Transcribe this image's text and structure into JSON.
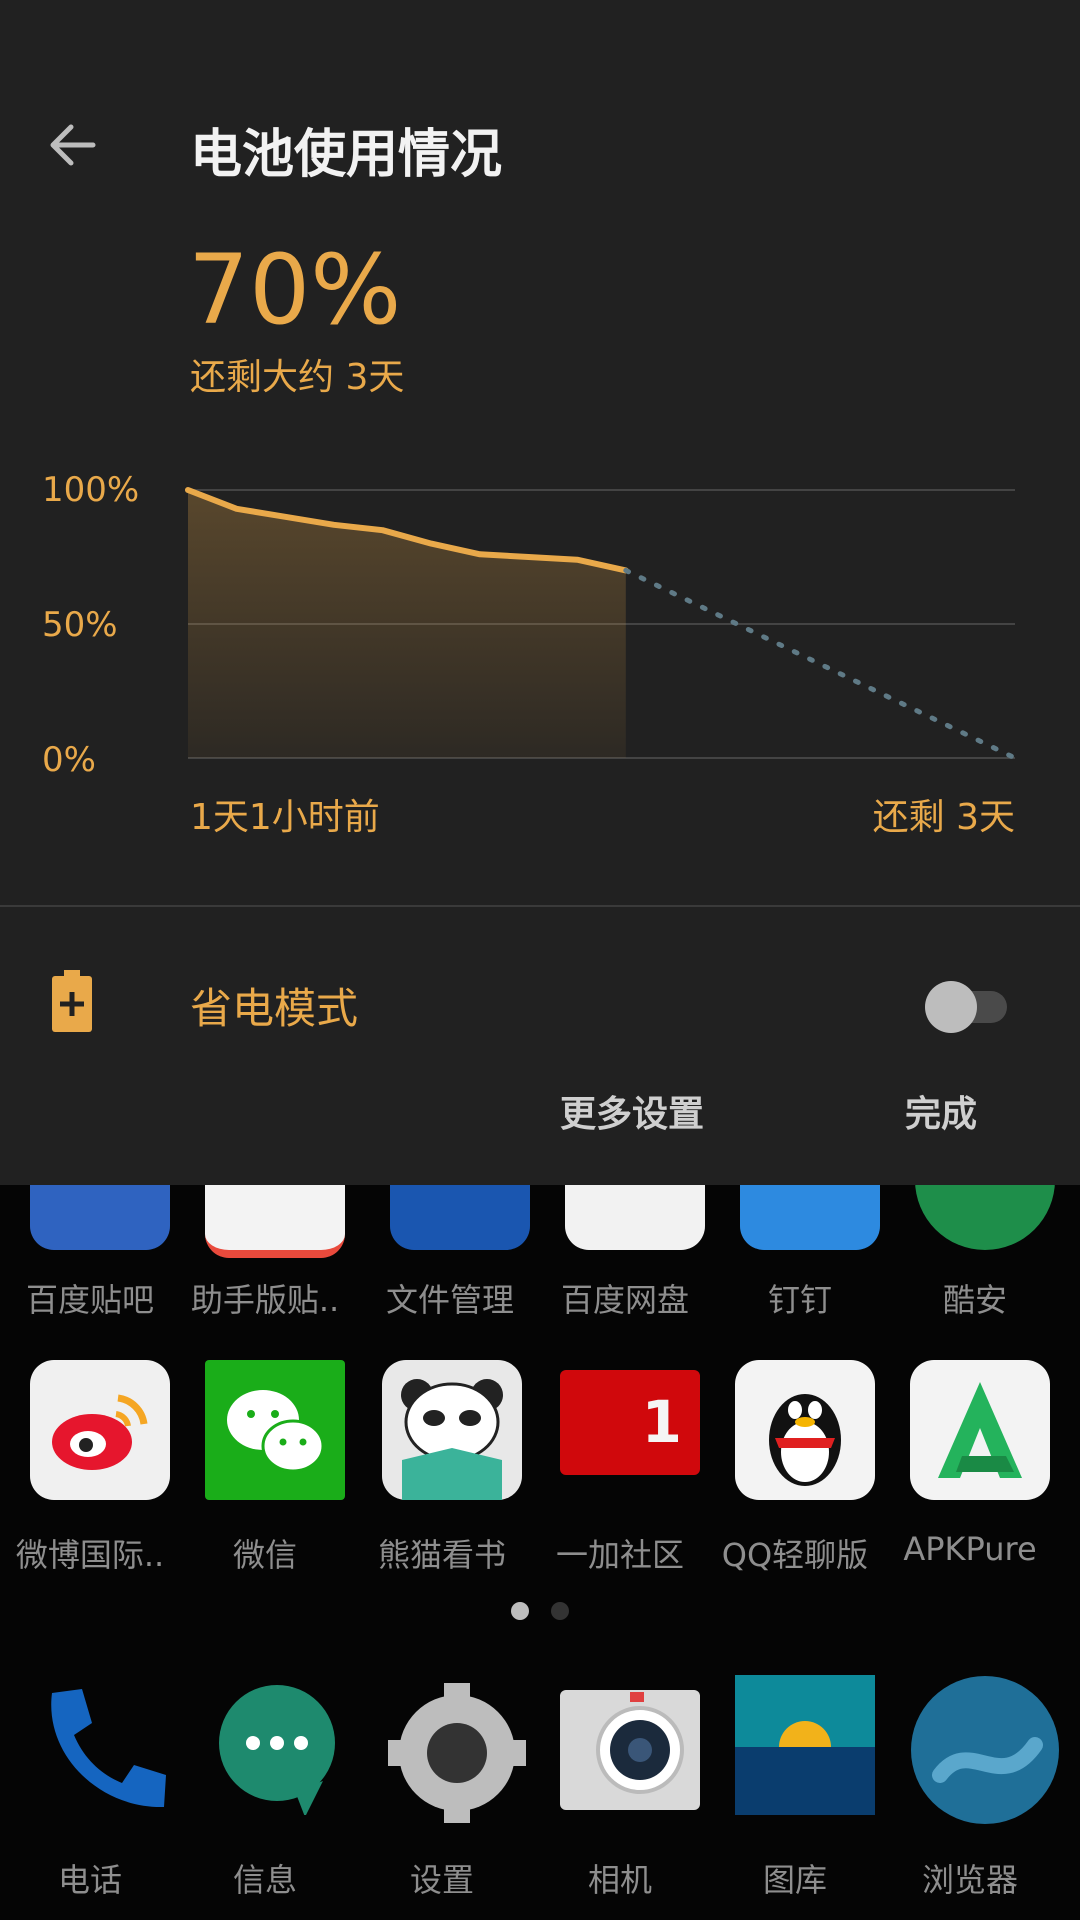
{
  "panel": {
    "title": "电池使用情况",
    "percent": "70%",
    "remaining": "还剩大约 3天",
    "y_labels": [
      "100%",
      "50%",
      "0%"
    ],
    "x_start": "1天1小时前",
    "x_end": "还剩 3天",
    "saver_label": "省电模式",
    "saver_on": false,
    "more_settings": "更多设置",
    "done": "完成",
    "accent": "#e9a94a"
  },
  "chart_data": {
    "type": "line",
    "series": [
      {
        "values": [
          100,
          93,
          90,
          87,
          85,
          80,
          76,
          75,
          74,
          70
        ]
      },
      {
        "values": [
          70,
          0
        ]
      }
    ],
    "ylim": [
      0,
      100
    ]
  },
  "home": {
    "row1": [
      "百度贴吧",
      "助手版贴..",
      "文件管理",
      "百度网盘",
      "钉钉",
      "酷安"
    ],
    "row2": [
      "微博国际..",
      "微信",
      "熊猫看书",
      "一加社区",
      "QQ轻聊版",
      "APKPure"
    ],
    "dock": [
      "电话",
      "信息",
      "设置",
      "相机",
      "图库",
      "浏览器"
    ],
    "community_badge": "1",
    "page_count": 2,
    "active_page": 1
  }
}
